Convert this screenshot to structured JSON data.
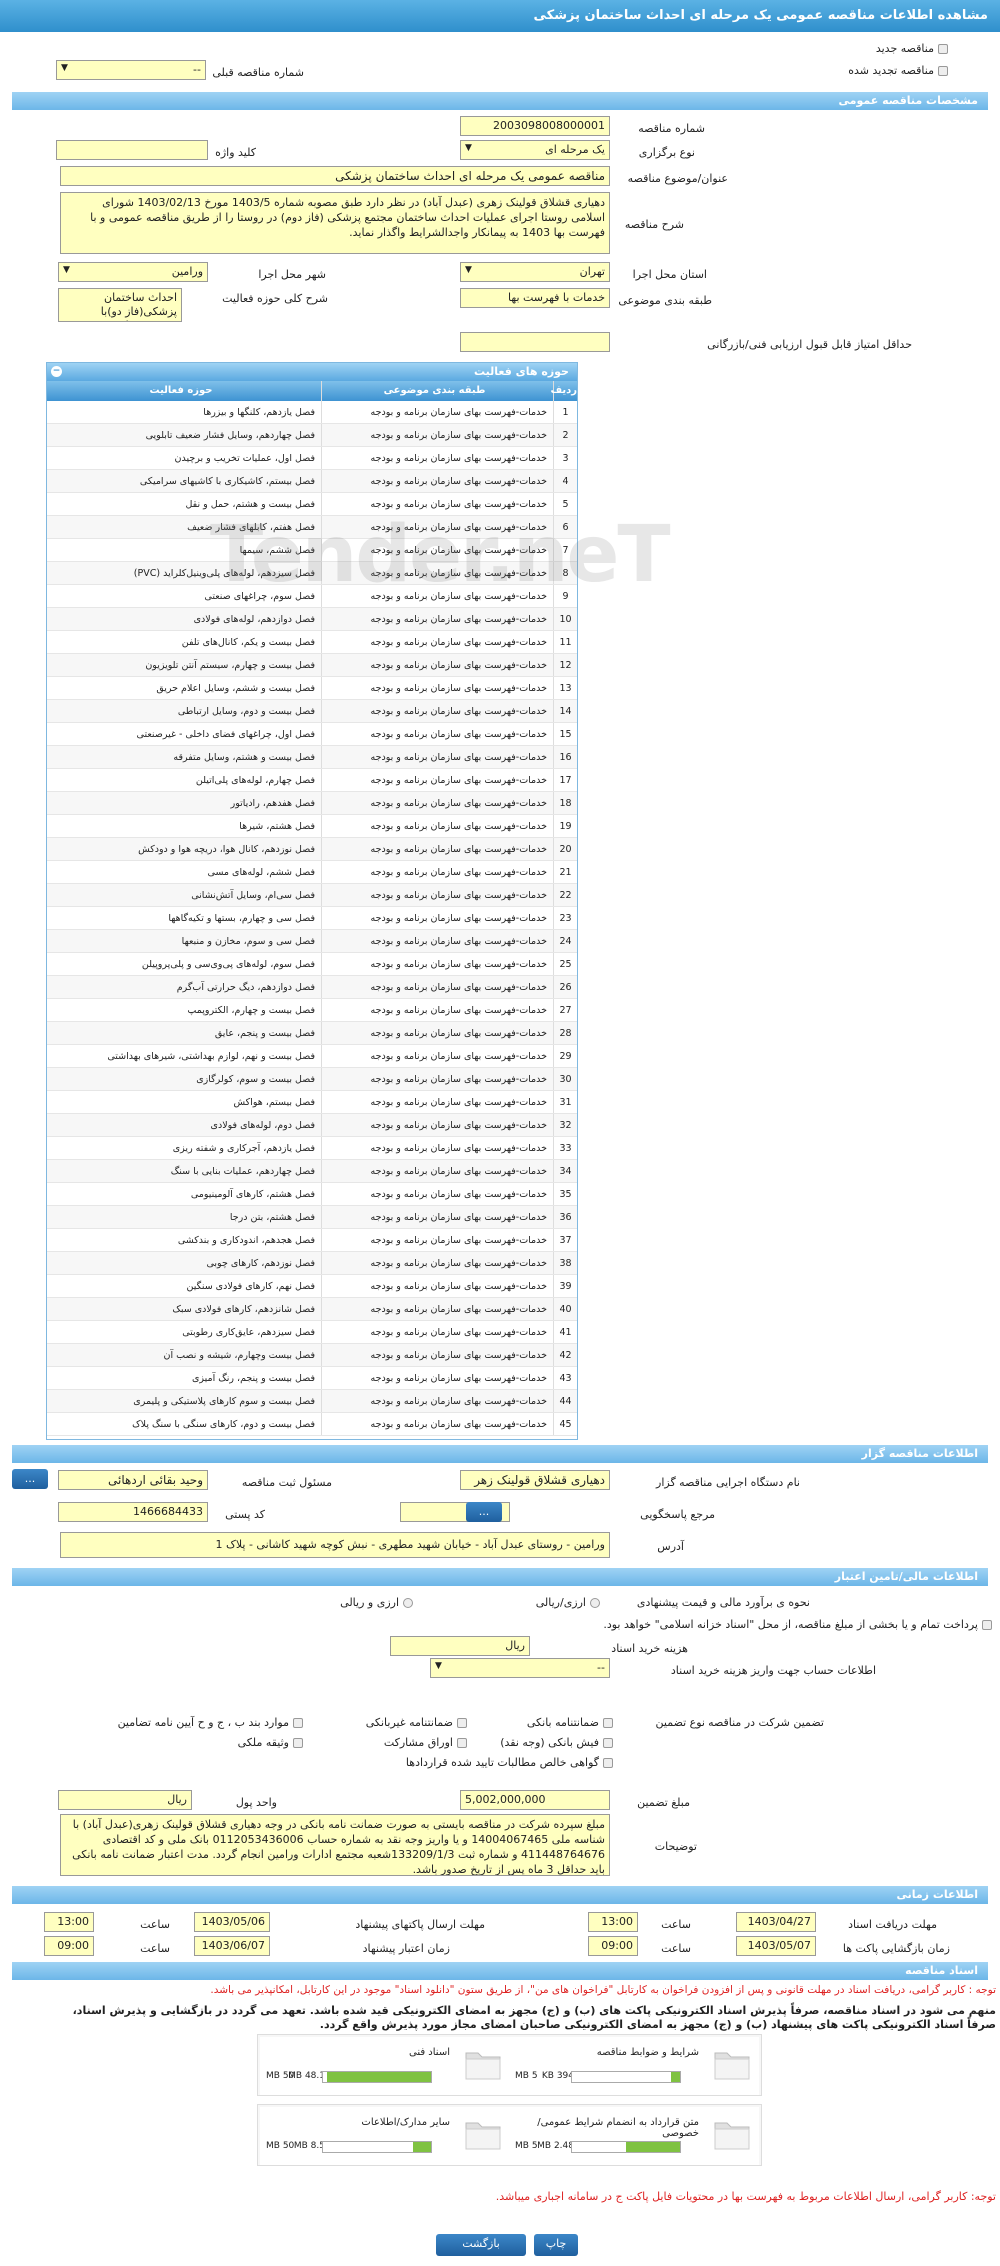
{
  "page_title": "مشاهده اطلاعات مناقصه عمومی یک مرحله ای احداث ساختمان پزشکی",
  "top": {
    "new_label": "مناقصه جدید",
    "renewed_label": "مناقصه تجدید شده",
    "prev_number_label": "شماره مناقصه قبلی",
    "prev_number_value": "--"
  },
  "general": {
    "section": "مشخصات مناقصه عمومی",
    "number_label": "شماره مناقصه",
    "number_value": "2003098008000001",
    "type_label": "نوع برگزاری",
    "type_value": "یک مرحله ای",
    "keyword_label": "کلید واژه",
    "keyword_value": "",
    "subject_label": "عنوان/موضوع مناقصه",
    "subject_value": "مناقصه عمومی یک مرحله ای  احداث ساختمان پزشکی",
    "desc_label": "شرح مناقصه",
    "desc_value": "دهیاری قشلاق قولینک زهری (عبدل آباد) در نظر دارد طبق مصوبه شماره 1403/5 مورخ 1403/02/13 شورای اسلامی روستا اجرای عملیات احداث ساختمان مجتمع پزشکی (فاز دوم) در روستا را از طریق مناقصه عمومی و با فهرست بها 1403 به پیمانکار واجدالشرایط واگذار نماید.",
    "province_label": "استان محل اجرا",
    "province_value": "تهران",
    "city_label": "شهر محل اجرا",
    "city_value": "ورامین",
    "category_label": "طبقه بندی موضوعی",
    "category_value": "خدمات با فهرست بها",
    "scope_label": "شرح کلی حوزه فعالیت",
    "scope_value": "احداث ساختمان پزشکی(فاز دو)با فهرست بها 1403",
    "min_score_label": "حداقل امتیاز قابل قبول ارزیابی فنی/بازرگانی",
    "min_score_value": ""
  },
  "activities": {
    "title": "حوزه های فعالیت",
    "col_idx": "ردیف",
    "col_cat": "طبقه بندی موضوعی",
    "col_act": "حوزه فعالیت",
    "cat": "خدمات-فهرست بهای سازمان برنامه و بودجه",
    "rows": [
      "فصل یازدهم، کلنگها و بیزرها",
      "فصل چهاردهم، وسایل فشار ضعیف تابلویی",
      "فصل اول، عملیات تخریب و برچیدن",
      "فصل بیستم، کاشیکاری با کاشیهای سرامیکی",
      "فصل بیست و هشتم، حمل و نقل",
      "فصل هفتم، کابلهای فشار ضعیف",
      "فصل ششم، سیمها",
      "فصل سیزدهم، لوله‌های پلی‌وینیل‌کلراید (PVC)",
      "فصل سوم، چراغهای صنعتی",
      "فصل دوازدهم، لوله‌های فولادی",
      "فصل بیست و یکم، کانال‌های تلفن",
      "فصل بیست و چهارم، سیستم آنتن تلویزیون",
      "فصل بیست و ششم، وسایل اعلام حریق",
      "فصل بیست و دوم، وسایل ارتباطی",
      "فصل اول، چراغهای فضای داخلی - غیرصنعتی",
      "فصل بیست و هشتم، وسایل متفرقه",
      "فصل چهارم، لوله‌های پلی‌اتیلن",
      "فصل هفدهم، رادیاتور",
      "فصل هشتم، شیرها",
      "فصل نوزدهم، کانال هوا، دریچه هوا و دودکش",
      "فصل ششم، لوله‌های مسی",
      "فصل سی‌ام، وسایل آتش‌نشانی",
      "فصل سی و چهارم، بستها و تکیه‌گاهها",
      "فصل سی و سوم، مخازن و منبعها",
      "فصل سوم، لوله‌های پی‌وی‌سی و پلی‌پروپیلن",
      "فصل دوازدهم، دیگ حرارتی آب‌گرم",
      "فصل بیست و چهارم، الکتروپمپ",
      "فصل بیست و پنجم، عایق",
      "فصل بیست و نهم، لوازم بهداشتی، شیرهای بهداشتی",
      "فصل بیست و سوم، کولرگازی",
      "فصل بیستم، هواکش",
      "فصل دوم، لوله‌های فولادی",
      "فصل یازدهم، آجرکاری و شفته ریزی",
      "فصل چهاردهم، عملیات بنایی با سنگ",
      "فصل هشتم، کارهای آلومینیومی",
      "فصل هشتم، بتن درجا",
      "فصل هجدهم، اندودکاری و بندکشی",
      "فصل نوزدهم، کارهای چوبی",
      "فصل نهم، کارهای فولادی سنگین",
      "فصل شانزدهم، کارهای فولادی سبک",
      "فصل سیزدهم، عایق‌کاری رطوبتی",
      "فصل بیست وچهارم، شیشه و نصب آن",
      "فصل بیست و پنجم، رنگ آمیزی",
      "فصل بیست و سوم کارهای پلاستیکی و پلیمری",
      "فصل بیست و دوم، کارهای سنگی با سنگ پلاک"
    ]
  },
  "organizer": {
    "section": "اطلاعات مناقصه گزار",
    "device_label": "نام دستگاه اجرایی مناقصه گزار",
    "device_value": "دهیاری قشلاق قولینک زهر",
    "resp_label": "مسئول ثبت مناقصه",
    "resp_value": "وحید بقائی اردهائی",
    "ref_label": "مرجع پاسخگویی",
    "ref_value": "",
    "postal_label": "کد پستی",
    "postal_value": "1466684433",
    "address_label": "آدرس",
    "address_value": "ورامین - روستای عبدل آباد - خیابان شهید مطهری - نبش کوچه شهید کاشانی - پلاک 1",
    "btn_dots": "..."
  },
  "finance": {
    "section": "اطلاعات مالی/تامین اعتبار",
    "estimate_label": "نحوه ی برآورد مالی و قیمت پیشنهادی",
    "opt_rial_foreign": "ارزی/ریالی",
    "opt_foreign_rial": "ارزی و ریالی",
    "pay_note": "پرداخت تمام و یا بخشی از مبلغ مناقصه، از محل \"اسناد خزانه اسلامی\" خواهد بود.",
    "fee_label": "هزینه خرید اسناد",
    "fee_value": "ریال",
    "account_label": "اطلاعات حساب جهت واریز هزینه خرید اسناد",
    "account_value": "--"
  },
  "guarantee": {
    "label": "تضمین شرکت در مناقصه",
    "type_label": "نوع تضمین",
    "opts": [
      "ضمانتنامه بانکی",
      "ضمانتنامه غیربانکی",
      "موارد بند ب ، ج و ح آیین نامه تضامین",
      "فیش بانکی (وجه نقد)",
      "اوراق مشارکت",
      "وثیقه ملکی",
      "گواهی خالص مطالبات تایید شده قراردادها"
    ],
    "amount_label": "مبلغ تضمین",
    "amount_value": "5,002,000,000",
    "unit_label": "واحد پول",
    "unit_value": "ریال",
    "desc_label": "توضیحات",
    "desc_value": "مبلغ سپرده شرکت در مناقصه بایستی به صورت ضمانت نامه بانکی در وجه دهیاری قشلاق قولینک زهری(عبدل آباد) با شناسه ملی 14004067465 و یا واریز وجه نقد به شماره حساب 0112053436006 بانک ملی و کد اقتصادی 411448764676 و شماره ثبت 133209/1/3شعبه مجتمع ادارات ورامین انجام گردد. مدت اعتبار ضمانت نامه بانکی باید حداقل 3 ماه پس از تاریخ صدور باشد."
  },
  "timing": {
    "section": "اطلاعات زمانی",
    "doc_receive_label": "مهلت دریافت اسناد",
    "doc_receive_date": "1403/04/27",
    "doc_receive_time": "13:00",
    "send_label": "مهلت ارسال پاکتهای پیشنهاد",
    "send_date": "1403/05/06",
    "send_time": "13:00",
    "open_label": "زمان بازگشایی پاکت ها",
    "open_date": "1403/05/07",
    "open_time": "09:00",
    "validity_label": "زمان اعتبار پیشنهاد",
    "validity_date": "1403/06/07",
    "validity_time": "09:00",
    "time_label": "ساعت"
  },
  "docs": {
    "section": "اسناد مناقصه",
    "note1": "توجه : کاربر گرامی، دریافت اسناد در مهلت قانونی و پس از افزودن فراخوان به کارتابل \"فراخوان های من\"، از طریق ستون \"دانلود اسناد\" موجود در این کارتابل، امکانپذیر می باشد.",
    "note2": "منهم می شود در اسناد مناقصه، صرفاً پذیرش اسناد الکترونیکی پاکت های (ب) و (ج) مجهز به امضای الکترونیکی قید شده باشد. تعهد می گردد در بازگشایی و پذیرش اسناد،",
    "note3": "صرفاً اسناد الکترونیکی پاکت های پیشنهاد (ب) و (ج) مجهز به امضای الکترونیکی صاحبان امضای مجاز مورد پذیرش واقع گردد.",
    "files": [
      {
        "name": "شرایط و ضوابط مناقصه",
        "size": "394 KB",
        "max": "5 MB",
        "fill": 0.08
      },
      {
        "name": "اسناد فنی",
        "size": "48.1 MB",
        "max": "50 MB",
        "fill": 0.96
      },
      {
        "name": "متن قرارداد به انضمام شرایط عمومی/خصوصی",
        "size": "2.48 MB",
        "max": "5 MB",
        "fill": 0.5
      },
      {
        "name": "سایر مدارک/اطلاعات",
        "size": "8.5 MB",
        "max": "50 MB",
        "fill": 0.17
      }
    ],
    "bottom_note": "توجه: کاربر گرامی، ارسال اطلاعات مربوط به فهرست بها در محتویات فایل پاکت ج در سامانه اجباری میباشد."
  },
  "buttons": {
    "back": "بازگشت",
    "print": "چاپ"
  },
  "watermark": "Tender.neT"
}
